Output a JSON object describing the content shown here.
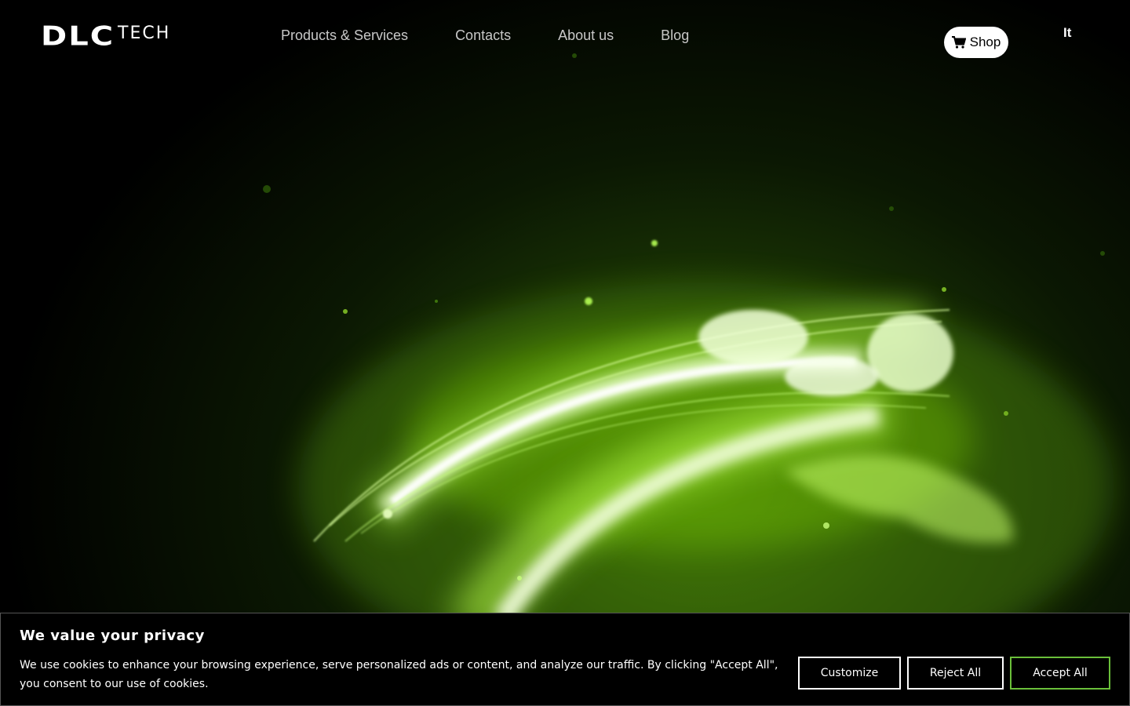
{
  "header": {
    "logo_main": "DLC",
    "logo_sub": "TECH",
    "nav": [
      {
        "label": "Products & Services"
      },
      {
        "label": "Contacts"
      },
      {
        "label": "About us"
      },
      {
        "label": "Blog"
      }
    ],
    "shop_label": "Shop",
    "shop_icon": "cart-icon",
    "language": "It"
  },
  "theme": {
    "accent": "#7fd100",
    "background": "#000000",
    "accept_border": "#6abf3a"
  },
  "cookie_banner": {
    "title": "We value your privacy",
    "text": "We use cookies to enhance your browsing experience, serve personalized ads or content, and analyze our traffic. By clicking \"Accept All\", you consent to our use of cookies.",
    "customize_label": "Customize",
    "reject_label": "Reject All",
    "accept_label": "Accept All"
  }
}
